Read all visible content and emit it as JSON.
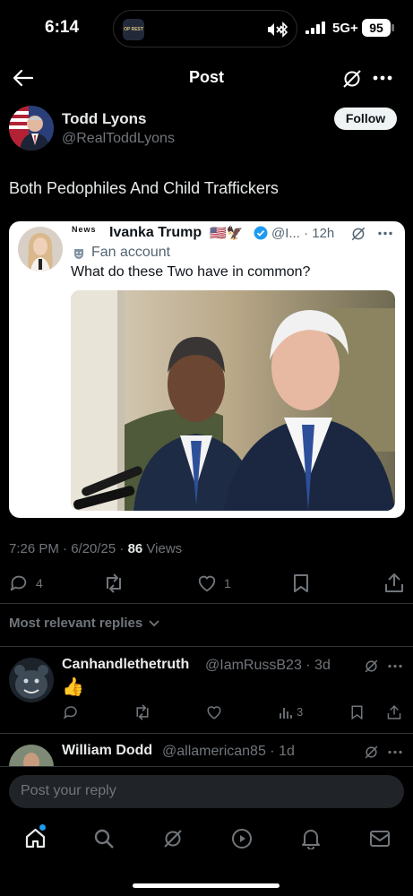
{
  "status_bar": {
    "time": "6:14",
    "network": "5G+",
    "battery": "95",
    "island_app_label": "OP REST"
  },
  "header": {
    "title": "Post",
    "icons": [
      "back-arrow-icon",
      "grok-icon",
      "more-icon"
    ]
  },
  "post": {
    "author_name": "Todd Lyons",
    "author_handle": "@RealToddLyons",
    "follow_label": "Follow",
    "text": "Both Pedophiles And Child Traffickers",
    "quoted": {
      "news_label": "News",
      "author_name": "Ivanka Trump",
      "author_flags": "🇺🇸🦅",
      "verified": true,
      "handle_time": "@I... · 12h",
      "fan_label": "Fan account",
      "text": "What do these Two have in common?"
    },
    "timestamp": "7:26 PM · 6/20/25 · ",
    "views_count": "86",
    "views_label": " Views",
    "actions": {
      "replies": "4",
      "reposts": "",
      "likes": "1"
    }
  },
  "sort_label": "Most relevant replies",
  "replies": [
    {
      "name": "Canhandlethetruth",
      "handle_time": "@IamRussB23 · 3d",
      "text": "👍",
      "views": "3"
    },
    {
      "name": "William Dodd",
      "handle_time": "@allamerican85 · 1d"
    }
  ],
  "composer": {
    "placeholder": "Post your reply"
  },
  "bottom_nav": [
    "home-icon",
    "search-icon",
    "grok-icon",
    "video-icon",
    "notifications-icon",
    "messages-icon"
  ],
  "colors": {
    "background": "#000000",
    "text": "#e7e9ea",
    "muted": "#71767b",
    "accent": "#1d9bf0",
    "divider": "#2f3336"
  }
}
